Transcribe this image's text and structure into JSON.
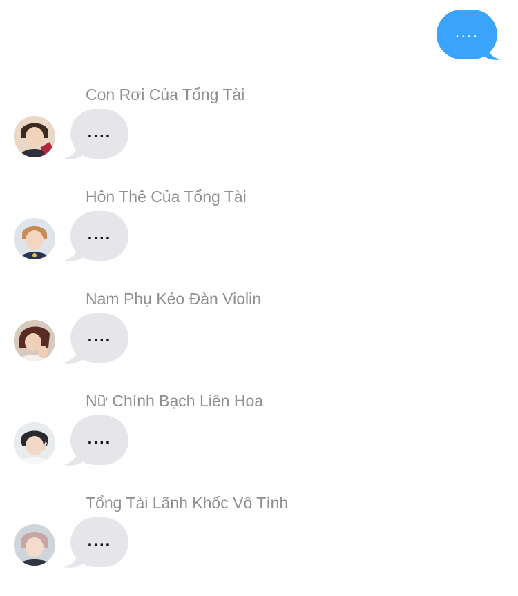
{
  "colors": {
    "sent_bubble": "#3aa3fc",
    "received_bubble": "#e5e5ea",
    "sender_name": "#8e8e93"
  },
  "sent_message": {
    "text": "...."
  },
  "threads": [
    {
      "sender": "Con Rơi Của Tổng Tài",
      "message": "....",
      "avatar_icon": "avatar-photo"
    },
    {
      "sender": "Hôn Thê Của Tổng Tài",
      "message": "....",
      "avatar_icon": "avatar-photo"
    },
    {
      "sender": "Nam Phụ Kéo Đàn Violin",
      "message": "....",
      "avatar_icon": "avatar-photo"
    },
    {
      "sender": "Nữ Chính Bạch Liên Hoa",
      "message": "....",
      "avatar_icon": "avatar-photo"
    },
    {
      "sender": "Tổng Tài Lãnh Khốc Vô Tình",
      "message": "....",
      "avatar_icon": "avatar-photo"
    }
  ]
}
